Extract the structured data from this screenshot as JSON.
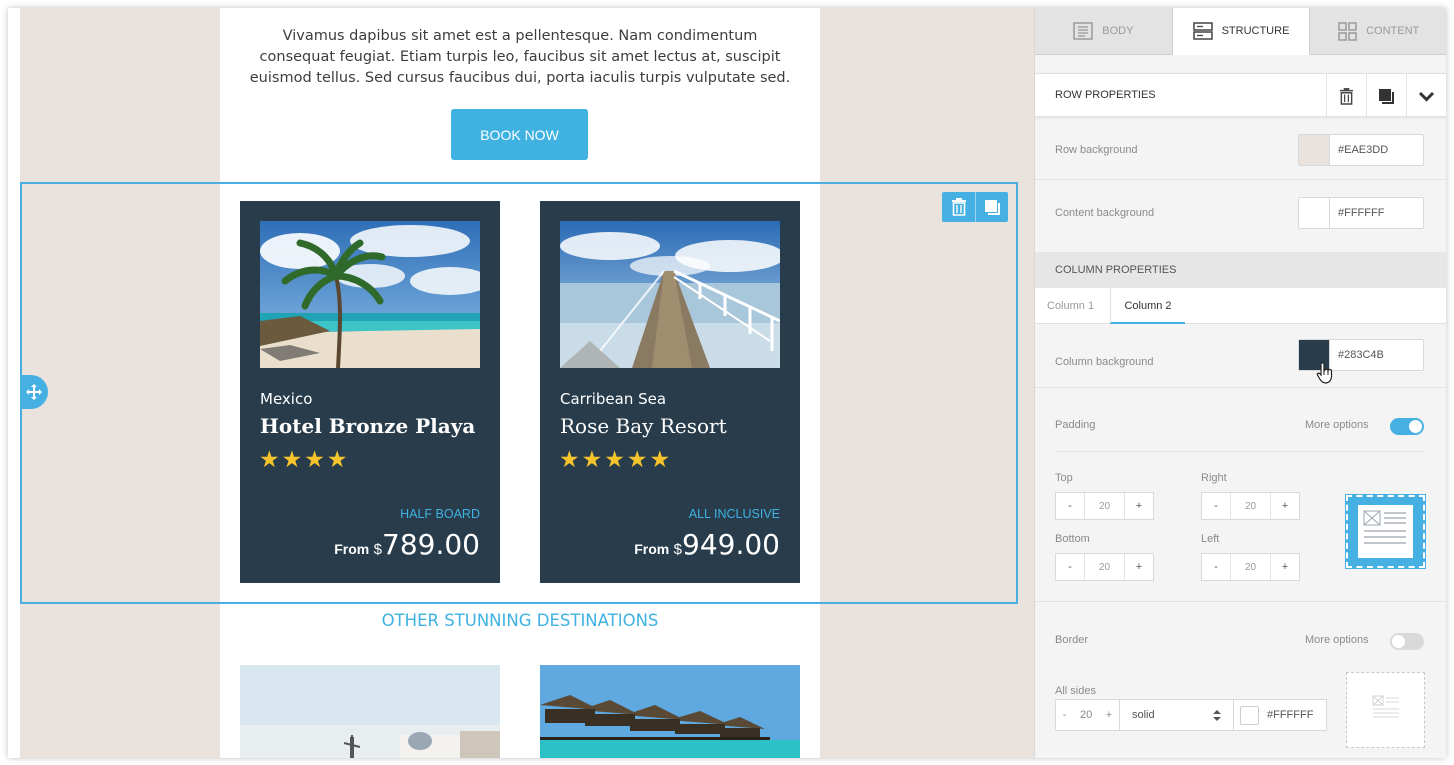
{
  "canvas": {
    "intro_text": "Vivamus dapibus sit amet est a pellentesque. Nam condimentum consequat feugiat. Etiam turpis leo, faucibus sit amet lectus at, suscipit euismod tellus. Sed cursus faucibus dui, porta iaculis turpis vulputate sed.",
    "book_button": "BOOK NOW",
    "cards": [
      {
        "location": "Mexico",
        "hotel": "Hotel Bronze Playa",
        "stars": "★★★★",
        "rating": 4,
        "plan": "HALF BOARD",
        "from": "From",
        "currency": "$",
        "price": "789.00"
      },
      {
        "location": "Carribean Sea",
        "hotel": "Rose Bay Resort",
        "stars": "★★★★★",
        "rating": 5,
        "plan": "ALL INCLUSIVE",
        "from": "From",
        "currency": "$",
        "price": "949.00"
      }
    ],
    "other_title": "OTHER STUNNING DESTINATIONS",
    "row_background_color": "#EAE3DD",
    "card_color": "#283C4B",
    "accent_color": "#3FB2E2"
  },
  "panel": {
    "tabs": [
      {
        "label": "BODY",
        "icon": "body-icon",
        "active": false
      },
      {
        "label": "STRUCTURE",
        "icon": "structure-icon",
        "active": true
      },
      {
        "label": "CONTENT",
        "icon": "content-grid-icon",
        "active": false
      }
    ],
    "row_properties": {
      "title": "ROW PROPERTIES",
      "row_background_label": "Row background",
      "row_background_value": "#EAE3DD",
      "content_background_label": "Content background",
      "content_background_value": "#FFFFFF"
    },
    "column_properties": {
      "title": "COLUMN PROPERTIES",
      "column_tabs": [
        "Column 1",
        "Column 2"
      ],
      "active_column": "Column 2",
      "column_background_label": "Column background",
      "column_background_value": "#283C4B",
      "padding": {
        "label": "Padding",
        "more_options": "More options",
        "more_options_on": true,
        "top_label": "Top",
        "top": "20",
        "right_label": "Right",
        "right": "20",
        "bottom_label": "Bottom",
        "bottom": "20",
        "left_label": "Left",
        "left": "20"
      },
      "border": {
        "label": "Border",
        "more_options": "More options",
        "more_options_on": false,
        "all_sides_label": "All sides",
        "width": "20",
        "style": "solid",
        "color": "#FFFFFF"
      }
    },
    "stepper_minus": "-",
    "stepper_plus": "+"
  }
}
